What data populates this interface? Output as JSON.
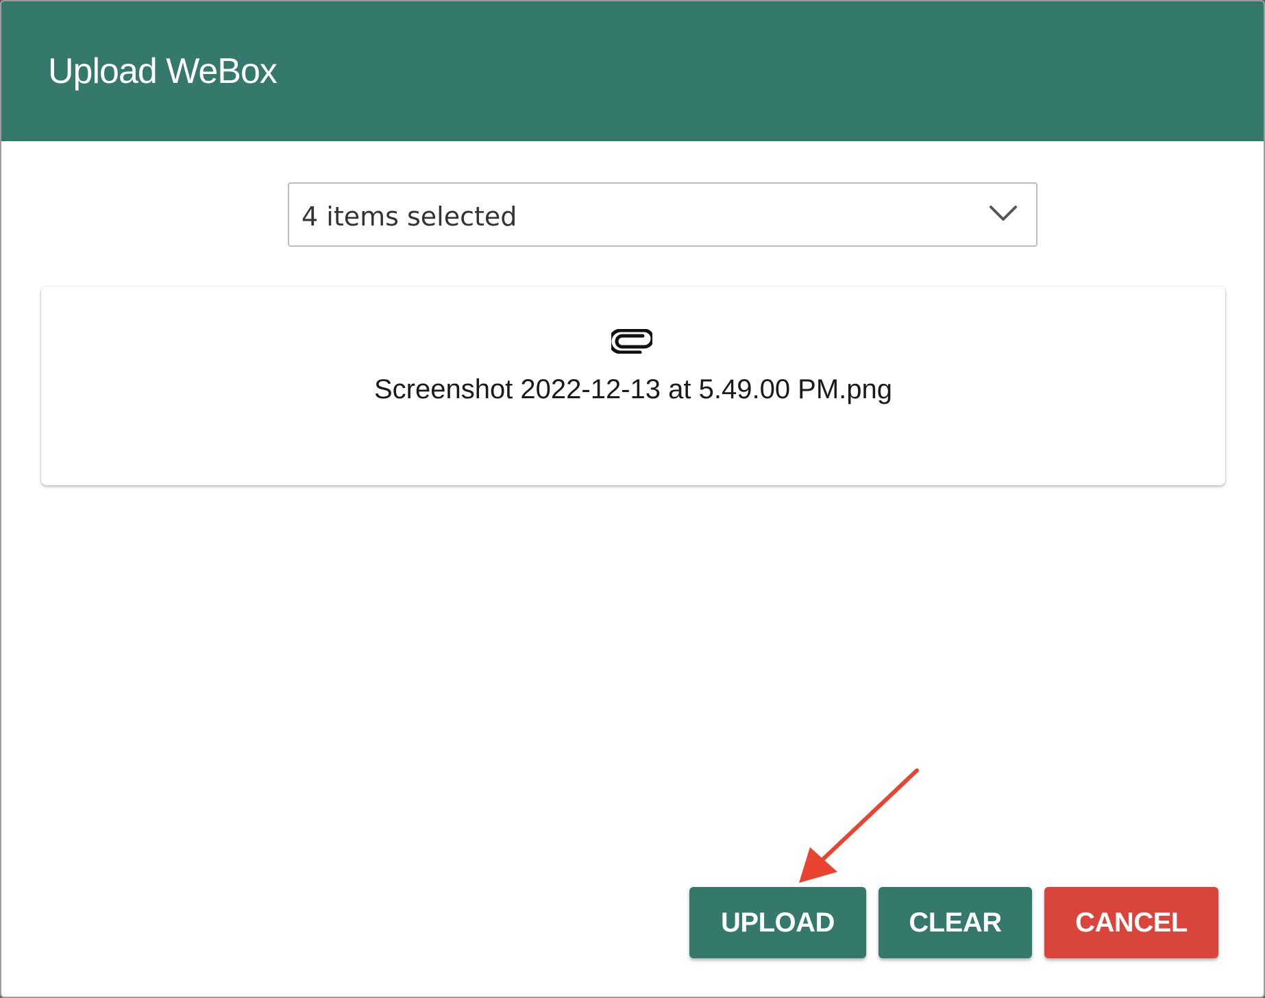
{
  "dialog": {
    "title": "Upload WeBox"
  },
  "select": {
    "value": "4 items selected",
    "icon": "chevron-down-icon"
  },
  "file": {
    "icon": "paperclip-icon",
    "name": "Screenshot 2022-12-13 at 5.49.00 PM.png"
  },
  "actions": {
    "upload_label": "UPLOAD",
    "clear_label": "CLEAR",
    "cancel_label": "CANCEL"
  },
  "colors": {
    "header": "#35796c",
    "primary_button": "#35796c",
    "cancel_button": "#d9453c",
    "annotation_arrow": "#e8442f"
  }
}
